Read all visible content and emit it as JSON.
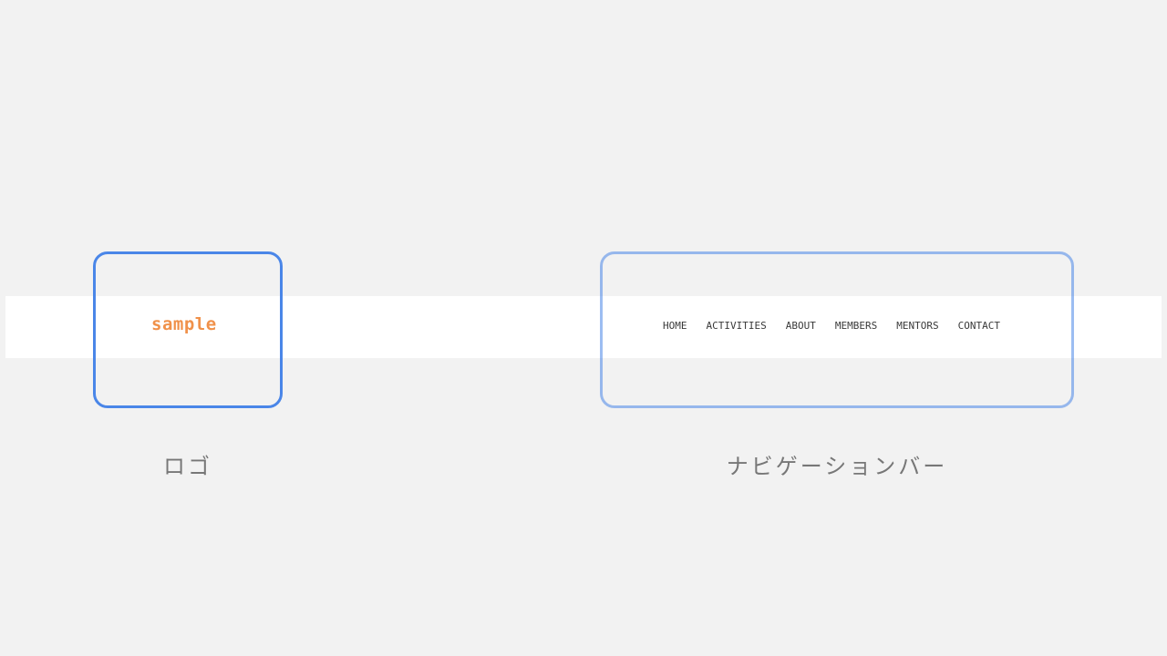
{
  "header": {
    "logo_text": "sample",
    "nav_items": [
      "HOME",
      "ACTIVITIES",
      "ABOUT",
      "MEMBERS",
      "MENTORS",
      "CONTACT"
    ]
  },
  "annotations": {
    "logo_caption": "ロゴ",
    "nav_caption": "ナビゲーションバー"
  },
  "colors": {
    "page_background": "#f2f2f2",
    "header_background": "#ffffff",
    "logo_color": "#f0914a",
    "callout_border": "#4a86e8",
    "caption_color": "#777777"
  }
}
